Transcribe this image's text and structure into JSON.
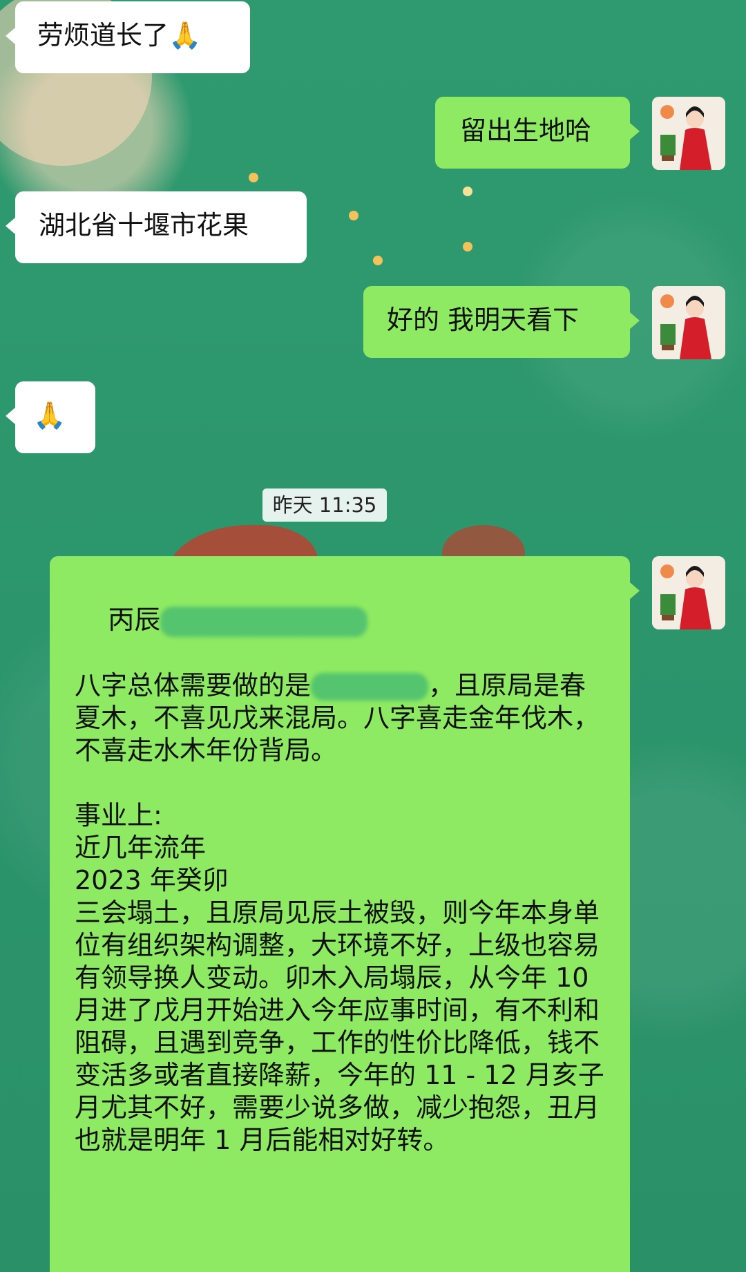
{
  "messages": [
    {
      "side": "left",
      "text": "劳烦道长了🙏"
    },
    {
      "side": "right",
      "text": "留出生地哈"
    },
    {
      "side": "left",
      "text": "湖北省十堰市花果"
    },
    {
      "side": "right",
      "text": "好的 我明天看下"
    },
    {
      "side": "left",
      "text": "🙏"
    }
  ],
  "timestamp": "昨天 11:35",
  "reading": {
    "line1_prefix": "丙辰",
    "line2_prefix": "八字总体需要做的是",
    "line2_suffix": "，且原局是春夏木，不喜见戊来混局。八字喜走金年伐木，不喜走水木年份背局。",
    "p_career_title": "事业上:",
    "p_recent": "近几年流年",
    "p_year": "2023 年癸卯",
    "p_body": "三会塌土，且原局见辰土被毁，则今年本身单位有组织架构调整，大环境不好，上级也容易有领导换人变动。卯木入局塌辰，从今年 10 月进了戊月开始进入今年应事时间，有不利和阻碍，且遇到竞争，工作的性价比降低，钱不变活多或者直接降薪，今年的 11 - 12 月亥子月尤其不好，需要少说多做，减少抱怨，丑月也就是明年 1 月后能相对好转。"
  },
  "colors": {
    "background": "#2f9a6f",
    "bubble_right": "#8eea62",
    "bubble_left": "#ffffff"
  },
  "icons": [
    "avatar-master",
    "praying-hands-emoji"
  ]
}
